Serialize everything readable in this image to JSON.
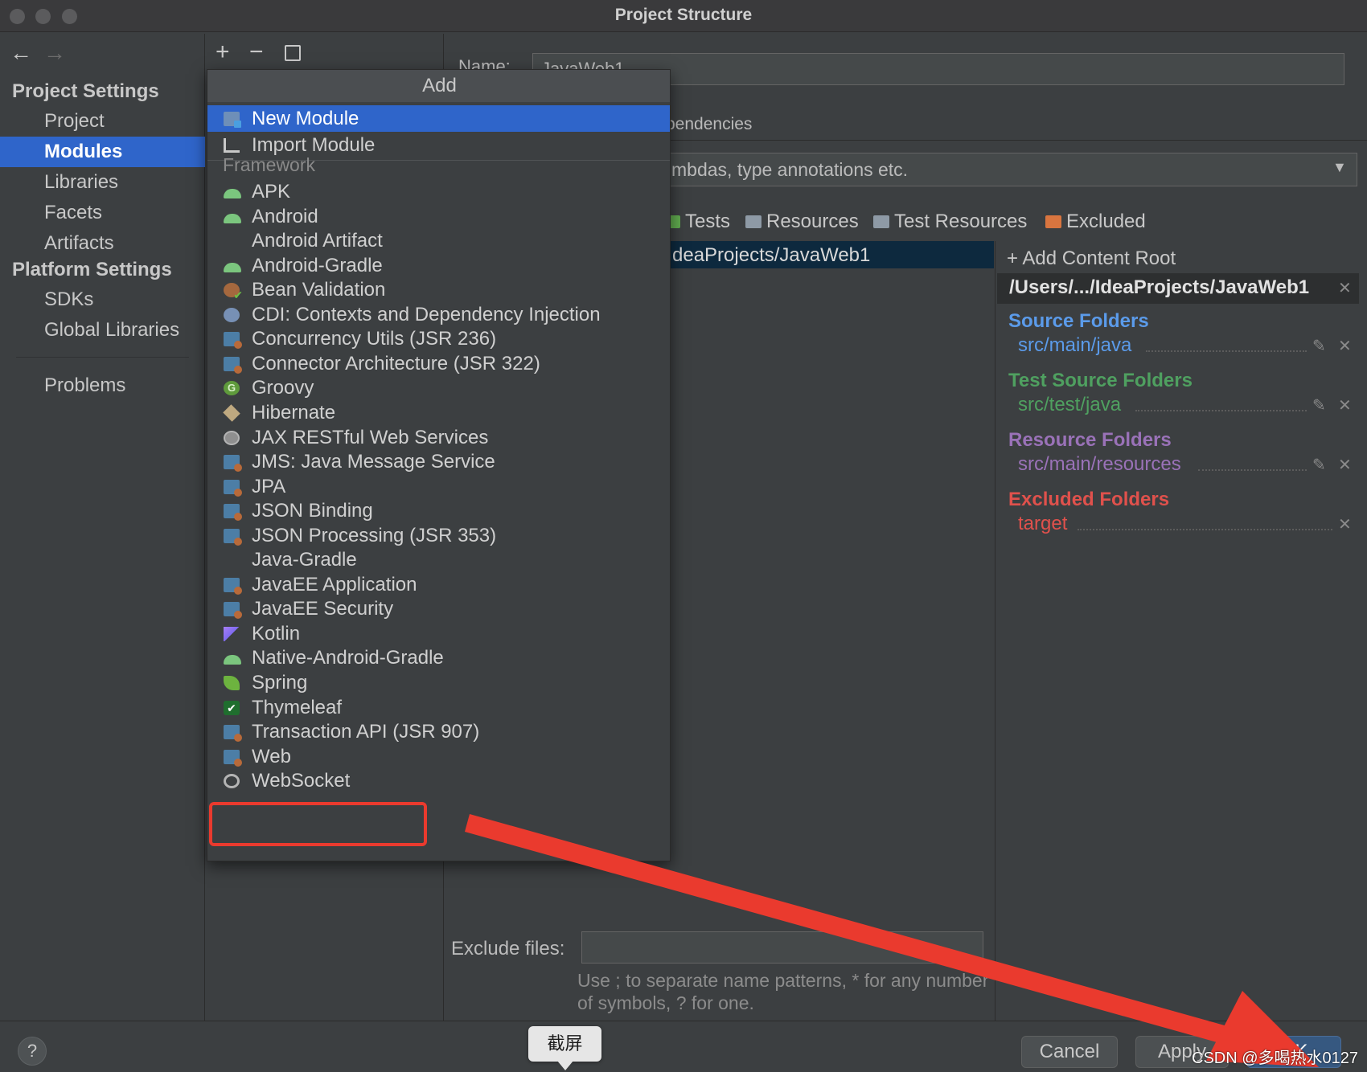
{
  "window": {
    "title": "Project Structure"
  },
  "nav": {
    "back_icon": "back-arrow-icon",
    "forward_icon": "forward-arrow-icon"
  },
  "sidebar": {
    "project_settings_header": "Project Settings",
    "project_items": [
      {
        "label": "Project",
        "selected": false
      },
      {
        "label": "Modules",
        "selected": true
      },
      {
        "label": "Libraries",
        "selected": false
      },
      {
        "label": "Facets",
        "selected": false
      },
      {
        "label": "Artifacts",
        "selected": false
      }
    ],
    "platform_settings_header": "Platform Settings",
    "platform_items": [
      {
        "label": "SDKs"
      },
      {
        "label": "Global Libraries"
      }
    ],
    "problems_label": "Problems"
  },
  "modules_toolbar": {
    "add_icon": "plus-icon",
    "add_glyph": "+",
    "remove_icon": "minus-icon",
    "remove_glyph": "−",
    "copy_icon": "copy-icon"
  },
  "module_settings": {
    "name_label": "Name:",
    "name_value": "JavaWeb1",
    "dependencies_tab": "pendencies",
    "language_level": "mbdas, type annotations etc.",
    "mark_as": [
      {
        "label": "Tests",
        "color": "#5fa94e"
      },
      {
        "label": "Resources",
        "color": "#8e9aa6"
      },
      {
        "label": "Test Resources",
        "color": "#8e9aa6"
      },
      {
        "label": "Excluded",
        "color": "#d9753f"
      }
    ],
    "content_tree_path": "deaProjects/JavaWeb1",
    "exclude_files_label": "Exclude files:",
    "exclude_files_value": "",
    "exclude_hint": "Use ; to separate name patterns, * for any number of symbols, ? for one."
  },
  "content_roots": {
    "add_content_root": "+ Add Content Root",
    "root_path": "/Users/.../IdeaProjects/JavaWeb1",
    "close_glyph": "✕",
    "edit_glyph": "✎",
    "groups": [
      {
        "title": "Source Folders",
        "path": "src/main/java",
        "color": "#5b9bea",
        "path_color": "#5b9bea",
        "editable": true
      },
      {
        "title": "Test Source Folders",
        "path": "src/test/java",
        "color": "#4fa060",
        "path_color": "#4fa060",
        "editable": true
      },
      {
        "title": "Resource Folders",
        "path": "src/main/resources",
        "color": "#9a72b8",
        "path_color": "#9a72b8",
        "editable": true
      },
      {
        "title": "Excluded Folders",
        "path": "target",
        "color": "#e0514c",
        "path_color": "#e0514c",
        "editable": false
      }
    ]
  },
  "add_popup": {
    "title": "Add",
    "top_items": [
      {
        "label": "New Module",
        "icon": "module-icon",
        "selected": true
      },
      {
        "label": "Import Module",
        "icon": "import-icon",
        "selected": false
      }
    ],
    "framework_header": "Framework",
    "framework_items": [
      {
        "label": "APK",
        "icon": "android-icon"
      },
      {
        "label": "Android",
        "icon": "android-icon"
      },
      {
        "label": "Android Artifact",
        "icon": ""
      },
      {
        "label": "Android-Gradle",
        "icon": "android-icon"
      },
      {
        "label": "Bean Validation",
        "icon": "bean-validation-icon"
      },
      {
        "label": "CDI: Contexts and Dependency Injection",
        "icon": "cdi-icon"
      },
      {
        "label": "Concurrency Utils (JSR 236)",
        "icon": "javaee-icon"
      },
      {
        "label": "Connector Architecture (JSR 322)",
        "icon": "javaee-icon"
      },
      {
        "label": "Groovy",
        "icon": "groovy-icon"
      },
      {
        "label": "Hibernate",
        "icon": "hibernate-icon"
      },
      {
        "label": "JAX RESTful Web Services",
        "icon": "globe-icon"
      },
      {
        "label": "JMS: Java Message Service",
        "icon": "javaee-icon"
      },
      {
        "label": "JPA",
        "icon": "javaee-icon"
      },
      {
        "label": "JSON Binding",
        "icon": "javaee-icon"
      },
      {
        "label": "JSON Processing (JSR 353)",
        "icon": "javaee-icon"
      },
      {
        "label": "Java-Gradle",
        "icon": ""
      },
      {
        "label": "JavaEE Application",
        "icon": "javaee-icon"
      },
      {
        "label": "JavaEE Security",
        "icon": "javaee-icon"
      },
      {
        "label": "Kotlin",
        "icon": "kotlin-icon"
      },
      {
        "label": "Native-Android-Gradle",
        "icon": "android-icon"
      },
      {
        "label": "Spring",
        "icon": "spring-icon"
      },
      {
        "label": "Thymeleaf",
        "icon": "thymeleaf-icon"
      },
      {
        "label": "Transaction API (JSR 907)",
        "icon": "javaee-icon"
      },
      {
        "label": "Web",
        "icon": "web-icon",
        "highlighted": true
      },
      {
        "label": "WebSocket",
        "icon": "websocket-icon"
      }
    ]
  },
  "footer": {
    "help_label": "?",
    "cancel_label": "Cancel",
    "apply_label": "Apply",
    "ok_label": "OK"
  },
  "tooltip": {
    "text": "截屏"
  },
  "watermark": {
    "text": "CSDN @多喝热水0127"
  },
  "annotation": {
    "color": "#ea3a2e"
  }
}
